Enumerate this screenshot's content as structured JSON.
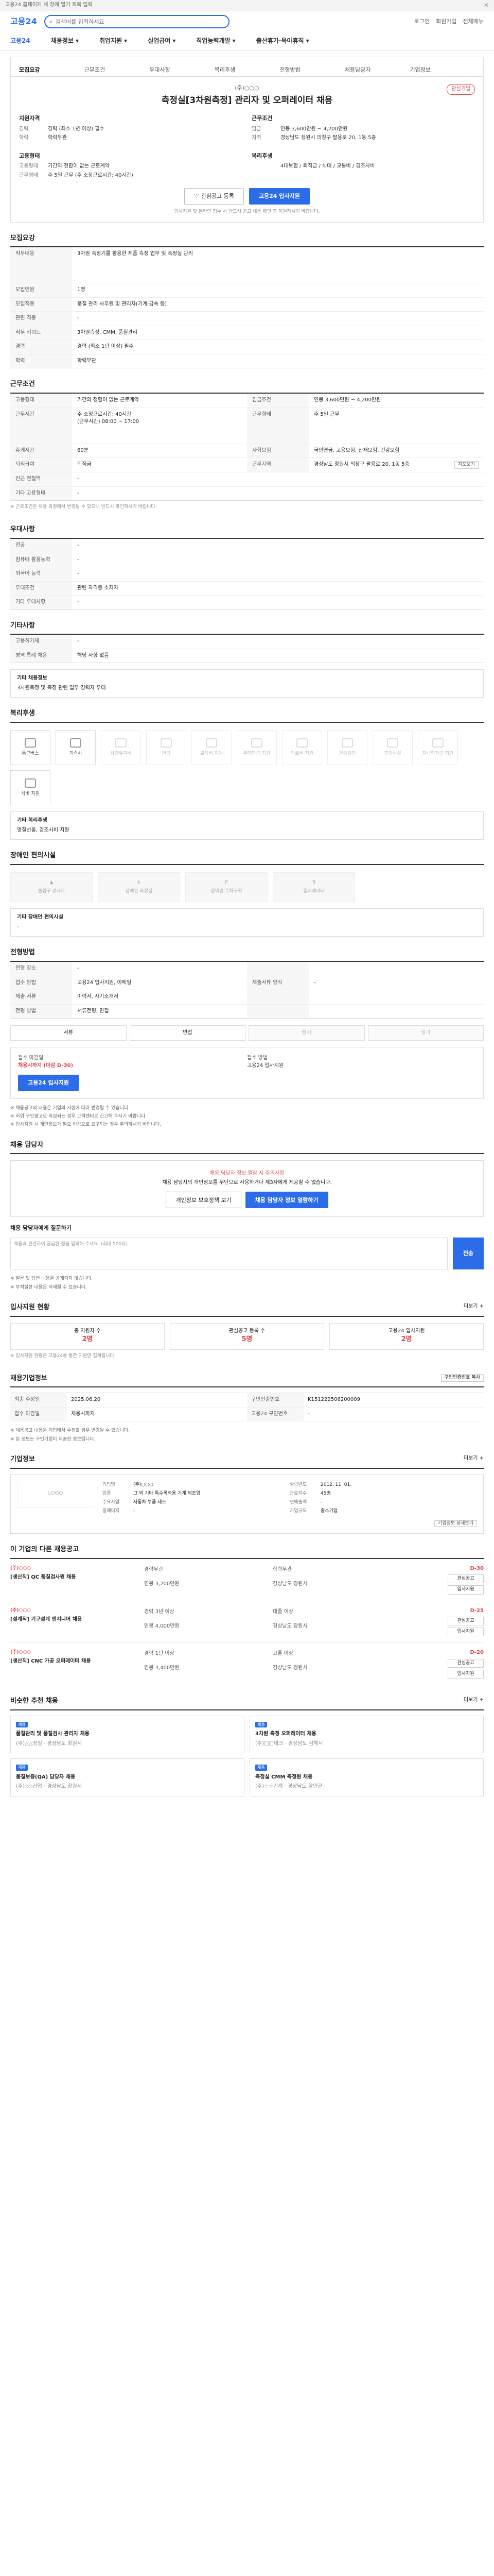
{
  "topbar": {
    "text": "고용24 홈페이지 새 창에 열기 제목 입력",
    "close": "✕"
  },
  "header": {
    "logo": "고용24",
    "search_placeholder": "검색어를 입력하세요",
    "links": [
      "로그인",
      "회원가입",
      "전체메뉴"
    ]
  },
  "gnb": {
    "brand": "고용24",
    "items": [
      "채용정보",
      "취업지원",
      "실업급여",
      "직업능력개발",
      "출산휴가·육아휴직"
    ]
  },
  "tabs": [
    "모집요강",
    "근무조건",
    "우대사항",
    "복리후생",
    "전형방법",
    "채용담당자",
    "기업정보"
  ],
  "posting": {
    "company": "(주)○○○",
    "title": "측정실[3차원측정] 관리자 및 오퍼레이터 채용",
    "fav": "관심기업",
    "left_head": "지원자격",
    "left_rows": [
      {
        "k": "경력",
        "v": "경력 (최소 1년 이상) 필수"
      },
      {
        "k": "학력",
        "v": "학력무관"
      }
    ],
    "right_head": "근무조건",
    "right_rows": [
      {
        "k": "임금",
        "v": "연봉 3,600만원 ~ 4,200만원"
      },
      {
        "k": "지역",
        "v": "경상남도 창원시 의창구 팔용로 20, 1동 5층"
      }
    ],
    "left2_head": "고용형태",
    "left2_rows": [
      {
        "k": "고용형태",
        "v": "기간의 정함이 없는 근로계약"
      },
      {
        "k": "근무형태",
        "v": "주 5일 근무 (주 소정근로시간: 40시간)"
      }
    ],
    "right2_head": "복리후생",
    "right2_rows": [
      {
        "k": "",
        "v": "4대보험 / 퇴직금 / 식대 / 교통비 / 경조사비"
      }
    ],
    "btn_scrap": "관심공고 등록",
    "btn_apply": "고용24 입사지원",
    "notice": "입사지원 및 온라인 접수 시 반드시 공고 내용 확인 후 지원하시기 바랍니다."
  },
  "recruit": {
    "title": "모집요강",
    "rows": [
      {
        "k": "직무내용",
        "v": "3차원 측정기를 활용한 제품 측정 업무 및 측정실 관리"
      },
      {
        "k": "모집인원",
        "v": "1명"
      },
      {
        "k": "모집직종",
        "v": "품질 관리 사무원 및 관리자(기계·금속 등)"
      },
      {
        "k": "관련 직종",
        "v": "-"
      },
      {
        "k": "직무 키워드",
        "v": "3차원측정, CMM, 품질관리"
      },
      {
        "k": "경력",
        "v": "경력 (최소 1년 이상) 필수"
      },
      {
        "k": "학력",
        "v": "학력무관"
      }
    ]
  },
  "work": {
    "title": "근무조건",
    "rows4": [
      {
        "k1": "고용형태",
        "v1": "기간의 정함이 없는 근로계약",
        "k2": "임금조건",
        "v2": "연봉 3,600만원 ~ 4,200만원"
      },
      {
        "k1": "근무시간",
        "v1": "주 소정근로시간: 40시간\n(근무시간) 08:00 ~ 17:00",
        "k2": "근무형태",
        "v2": "주 5일 근무"
      },
      {
        "k1": "휴게시간",
        "v1": "60분",
        "k2": "사회보험",
        "v2": "국민연금, 고용보험, 산재보험, 건강보험"
      },
      {
        "k1": "퇴직급여",
        "v1": "퇴직금",
        "k2": "근무지역",
        "v2": "경상남도 창원시 의창구 팔용로 20, 1동 5층"
      }
    ],
    "rows": [
      {
        "k": "인근 전철역",
        "v": "-"
      },
      {
        "k": "기타 고용형태",
        "v": "-"
      }
    ],
    "map_btn": "지도보기",
    "note": "※ 근로조건은 채용 과정에서 변경될 수 있으니 반드시 확인하시기 바랍니다."
  },
  "prefer": {
    "title": "우대사항",
    "rows": [
      {
        "k": "전공",
        "v": "-"
      },
      {
        "k": "컴퓨터 활용능력",
        "v": "-"
      },
      {
        "k": "외국어 능력",
        "v": "-"
      },
      {
        "k": "우대조건",
        "v": "관련 자격증 소지자"
      },
      {
        "k": "기타 우대사항",
        "v": "-"
      }
    ]
  },
  "other": {
    "title": "기타사항",
    "rows": [
      {
        "k": "고용허가제",
        "v": "-"
      },
      {
        "k": "병역 특례 채용",
        "v": "해당 사항 없음"
      }
    ],
    "box_h": "기타 채용정보",
    "box_v": "3차원측정 및 측정 관련 업무 경력자 우대"
  },
  "welfare": {
    "title": "복리후생",
    "items": [
      {
        "label": "통근버스",
        "on": true
      },
      {
        "label": "기숙사",
        "on": true
      },
      {
        "label": "차량유지비",
        "on": false
      },
      {
        "label": "연금",
        "on": false
      },
      {
        "label": "교육비 지원",
        "on": false
      },
      {
        "label": "주택자금 지원",
        "on": false
      },
      {
        "label": "의료비 지원",
        "on": false
      },
      {
        "label": "건강검진",
        "on": false
      },
      {
        "label": "휴양시설",
        "on": false
      },
      {
        "label": "자녀학자금 지원",
        "on": false
      },
      {
        "label": "식비 지원",
        "on": true
      }
    ],
    "box_h": "기타 복리후생",
    "box_v": "명절선물, 경조사비 지원",
    "disab_title": "장애인 편의시설",
    "disab_items": [
      "출입구 경사로",
      "장애인 화장실",
      "장애인 주차구역",
      "엘리베이터"
    ],
    "disab_box_h": "기타 장애인 편의시설",
    "disab_box_v": "-"
  },
  "process": {
    "title": "전형방법",
    "rows4": [
      {
        "k1": "전형 장소",
        "v1": "-",
        "k2": "",
        "v2": ""
      },
      {
        "k1": "접수 방법",
        "v1": "고용24 입사지원, 이메일",
        "k2": "제출서류 양식",
        "v2": "-"
      },
      {
        "k1": "제출 서류",
        "v1": "이력서, 자기소개서",
        "k2": "",
        "v2": ""
      },
      {
        "k1": "전형 방법",
        "v1": "서류전형, 면접",
        "k2": "",
        "v2": ""
      }
    ],
    "methods": [
      "서류",
      "면접",
      "필기",
      "실기"
    ],
    "methods_on": [
      true,
      true,
      false,
      false
    ],
    "apply_h": "접수 마감일",
    "apply_v": "채용시까지 (마감 D-30)",
    "apply_h2": "접수 방법",
    "apply_v2": "고용24 입사지원",
    "apply_btn": "고용24 입사지원",
    "bullets": [
      "※ 채용공고의 내용은 기업의 사정에 따라 변경될 수 있습니다.",
      "※ 허위 구인광고로 의심되는 경우 고객센터로 신고해 주시기 바랍니다.",
      "※ 입사지원 시 개인정보가 필요 이상으로 요구되는 경우 주의하시기 바랍니다."
    ]
  },
  "contact": {
    "title": "채용 담당자",
    "line1": "채용 담당자 정보 열람 시 주의사항",
    "line2": "채용 담당자의 개인정보를 무단으로 사용하거나 제3자에게 제공할 수 없습니다.",
    "btn1": "개인정보 보호정책 보기",
    "btn2": "채용 담당자 정보 열람하기",
    "q_title": "채용 담당자에게 질문하기",
    "q_placeholder": "채용과 관련하여 궁금한 점을 입력해 주세요. (최대 500자)",
    "q_send": "전송",
    "q_notes": [
      "※ 질문 및 답변 내용은 공개되지 않습니다.",
      "※ 부적절한 내용은 삭제될 수 있습니다."
    ]
  },
  "stats": {
    "title": "입사지원 현황",
    "more": "더보기 +",
    "items": [
      {
        "label": "총 지원자 수",
        "n": "2명"
      },
      {
        "label": "관심공고 등록 수",
        "n": "5명"
      },
      {
        "label": "고용24 입사지원",
        "n": "2명"
      }
    ],
    "note": "※ 입사지원 현황은 고용24를 통한 지원만 집계됩니다."
  },
  "info": {
    "title": "채용기업정보",
    "print_btn": "구인인증번호 복사",
    "rows": [
      {
        "k1": "최종 수정일",
        "v1": "2025.06.20",
        "k2": "구인인증번호",
        "v2": "K151222506200009"
      },
      {
        "k1": "접수 마감일",
        "v1": "채용시까지",
        "k2": "고용24 구인번호",
        "v2": "-"
      }
    ],
    "notes": [
      "※ 채용공고 내용을 기업에서 수정할 경우 변경될 수 있습니다.",
      "※ 본 정보는 구인기업이 제공한 정보입니다."
    ]
  },
  "corp": {
    "title": "기업정보",
    "more": "더보기 +",
    "logo": "LOGO",
    "rows": [
      {
        "k1": "기업명",
        "v1": "(주)○○○",
        "k2": "설립년도",
        "v2": "2012. 11. 01."
      },
      {
        "k1": "업종",
        "v1": "그 외 기타 특수목적용 기계 제조업",
        "k2": "근로자수",
        "v2": "45명"
      },
      {
        "k1": "주요사업",
        "v1": "자동차 부품 제조",
        "k2": "연매출액",
        "v2": "-"
      },
      {
        "k1": "홈페이지",
        "v1": "-",
        "k2": "기업규모",
        "v2": "중소기업"
      }
    ],
    "btn": "기업정보 상세보기"
  },
  "other_jobs": {
    "title": "이 기업의 다른 채용공고",
    "jobs": [
      {
        "co": "(주)○○○",
        "t": "[생산직] QC 품질검사원 채용",
        "m1": "경력무관",
        "m2": "학력무관",
        "m3": "연봉 3,200만원",
        "m4": "경상남도 창원시",
        "dday": "D-30",
        "b1": "관심공고",
        "b2": "입사지원"
      },
      {
        "co": "(주)○○○",
        "t": "[설계직] 기구설계 엔지니어 채용",
        "m1": "경력 3년 이상",
        "m2": "대졸 이상",
        "m3": "연봉 4,000만원",
        "m4": "경상남도 창원시",
        "dday": "D-25",
        "b1": "관심공고",
        "b2": "입사지원"
      },
      {
        "co": "(주)○○○",
        "t": "[생산직] CNC 가공 오퍼레이터 채용",
        "m1": "경력 1년 이상",
        "m2": "고졸 이상",
        "m3": "연봉 3,400만원",
        "m4": "경상남도 창원시",
        "dday": "D-20",
        "b1": "관심공고",
        "b2": "입사지원"
      }
    ]
  },
  "reco": {
    "title": "비슷한 추천 채용",
    "more": "더보기 +",
    "cards": [
      {
        "badge": "채용",
        "t": "품질관리 및 품질검사 관리자 채용",
        "c": "(주)△△정밀 · 경상남도 창원시"
      },
      {
        "badge": "채용",
        "t": "3차원 측정 오퍼레이터 채용",
        "c": "(주)□□테크 · 경상남도 김해시"
      },
      {
        "badge": "채용",
        "t": "품질보증(QA) 담당자 채용",
        "c": "(주)◇◇산업 · 경상남도 창원시"
      },
      {
        "badge": "채용",
        "t": "측정실 CMM 측정원 채용",
        "c": "(주)☆☆기계 · 경상남도 함안군"
      }
    ]
  }
}
